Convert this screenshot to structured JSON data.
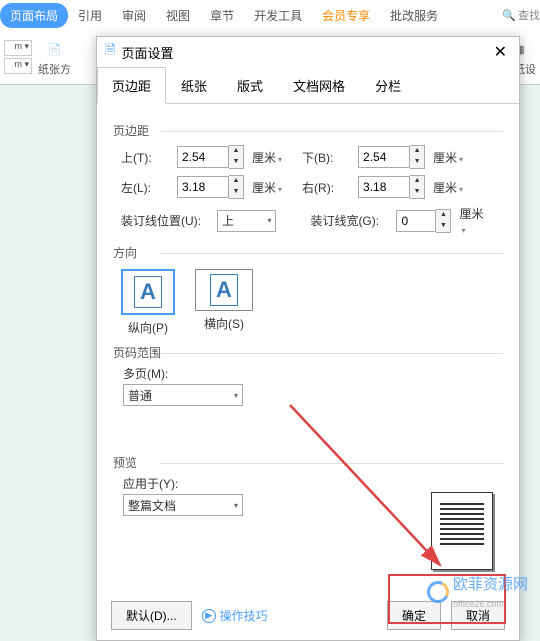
{
  "ribbon": {
    "tabs": [
      "页面布局",
      "引用",
      "审阅",
      "视图",
      "章节",
      "开发工具",
      "会员专享",
      "批改服务"
    ],
    "search": "查找",
    "paperDir": "纸张方",
    "paperSet": "稿纸设"
  },
  "dialog": {
    "title": "页面设置",
    "tabs": [
      "页边距",
      "纸张",
      "版式",
      "文档网格",
      "分栏"
    ],
    "margins": {
      "group": "页边距",
      "top": {
        "label": "上(T):",
        "value": "2.54"
      },
      "bottom": {
        "label": "下(B):",
        "value": "2.54"
      },
      "left": {
        "label": "左(L):",
        "value": "3.18"
      },
      "right": {
        "label": "右(R):",
        "value": "3.18"
      },
      "gutterPos": {
        "label": "装订线位置(U):",
        "value": "上"
      },
      "gutterWidth": {
        "label": "装订线宽(G):",
        "value": "0"
      },
      "unit": "厘米"
    },
    "orientation": {
      "group": "方向",
      "portrait": "纵向(P)",
      "landscape": "横向(S)"
    },
    "pageRange": {
      "group": "页码范围",
      "multi": {
        "label": "多页(M):",
        "value": "普通"
      }
    },
    "preview": {
      "group": "预览",
      "applyTo": {
        "label": "应用于(Y):",
        "value": "整篇文档"
      }
    },
    "footer": {
      "default": "默认(D)...",
      "tips": "操作技巧",
      "ok": "确定",
      "cancel": "取消"
    }
  },
  "watermark": {
    "main": "欧菲资源网",
    "sub": "office26.com"
  }
}
